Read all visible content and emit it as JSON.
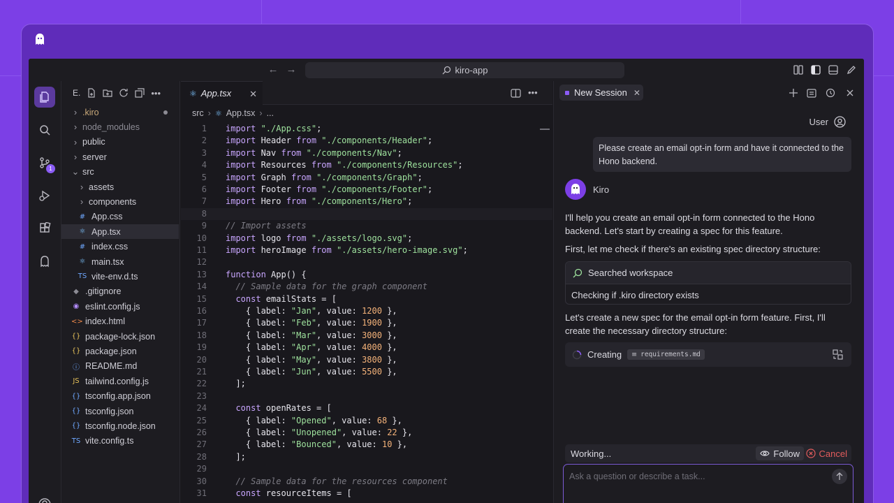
{
  "window": {
    "search": "kiro-app"
  },
  "explorer": {
    "title": "E.",
    "items": [
      {
        "label": ".kiro",
        "type": "folder",
        "open": false,
        "depth": 0,
        "color": "#c9a97a",
        "dot": true
      },
      {
        "label": "node_modules",
        "type": "folder",
        "open": false,
        "depth": 0,
        "dim": true
      },
      {
        "label": "public",
        "type": "folder",
        "open": false,
        "depth": 0
      },
      {
        "label": "server",
        "type": "folder",
        "open": false,
        "depth": 0
      },
      {
        "label": "src",
        "type": "folder",
        "open": true,
        "depth": 0
      },
      {
        "label": "assets",
        "type": "folder",
        "open": false,
        "depth": 1
      },
      {
        "label": "components",
        "type": "folder",
        "open": false,
        "depth": 1
      },
      {
        "label": "App.css",
        "type": "file",
        "icon": "#",
        "iconColor": "#6fa8ff",
        "depth": 1
      },
      {
        "label": "App.tsx",
        "type": "file",
        "icon": "⚛",
        "iconColor": "#7dc4ff",
        "depth": 1,
        "selected": true
      },
      {
        "label": "index.css",
        "type": "file",
        "icon": "#",
        "iconColor": "#6fa8ff",
        "depth": 1
      },
      {
        "label": "main.tsx",
        "type": "file",
        "icon": "⚛",
        "iconColor": "#7dc4ff",
        "depth": 1
      },
      {
        "label": "vite-env.d.ts",
        "type": "file",
        "icon": "TS",
        "iconColor": "#6fa8ff",
        "depth": 1
      },
      {
        "label": ".gitignore",
        "type": "file",
        "icon": "◆",
        "iconColor": "#8c8b94",
        "depth": 0
      },
      {
        "label": "eslint.config.js",
        "type": "file",
        "icon": "◉",
        "iconColor": "#b48cff",
        "depth": 0
      },
      {
        "label": "index.html",
        "type": "file",
        "icon": "<>",
        "iconColor": "#f08a4b",
        "depth": 0
      },
      {
        "label": "package-lock.json",
        "type": "file",
        "icon": "{}",
        "iconColor": "#e6c15a",
        "depth": 0
      },
      {
        "label": "package.json",
        "type": "file",
        "icon": "{}",
        "iconColor": "#e6c15a",
        "depth": 0
      },
      {
        "label": "README.md",
        "type": "file",
        "icon": "ⓘ",
        "iconColor": "#6fa8ff",
        "depth": 0
      },
      {
        "label": "tailwind.config.js",
        "type": "file",
        "icon": "JS",
        "iconColor": "#e6c15a",
        "depth": 0
      },
      {
        "label": "tsconfig.app.json",
        "type": "file",
        "icon": "{}",
        "iconColor": "#6fa8ff",
        "depth": 0
      },
      {
        "label": "tsconfig.json",
        "type": "file",
        "icon": "{}",
        "iconColor": "#6fa8ff",
        "depth": 0
      },
      {
        "label": "tsconfig.node.json",
        "type": "file",
        "icon": "{}",
        "iconColor": "#6fa8ff",
        "depth": 0
      },
      {
        "label": "vite.config.ts",
        "type": "file",
        "icon": "TS",
        "iconColor": "#6fa8ff",
        "depth": 0
      }
    ]
  },
  "activity": {
    "badge": "1"
  },
  "editor": {
    "tab": "App.tsx",
    "breadcrumb": {
      "folder": "src",
      "file": "App.tsx",
      "more": "..."
    },
    "current_line": 8,
    "lines": [
      [
        [
          "kw",
          "import "
        ],
        [
          "str",
          "\"./App.css\""
        ],
        [
          "id",
          ";"
        ]
      ],
      [
        [
          "kw",
          "import "
        ],
        [
          "id",
          "Header "
        ],
        [
          "kw",
          "from "
        ],
        [
          "str",
          "\"./components/Header\""
        ],
        [
          "id",
          ";"
        ]
      ],
      [
        [
          "kw",
          "import "
        ],
        [
          "id",
          "Nav "
        ],
        [
          "kw",
          "from "
        ],
        [
          "str",
          "\"./components/Nav\""
        ],
        [
          "id",
          ";"
        ]
      ],
      [
        [
          "kw",
          "import "
        ],
        [
          "id",
          "Resources "
        ],
        [
          "kw",
          "from "
        ],
        [
          "str",
          "\"./components/Resources\""
        ],
        [
          "id",
          ";"
        ]
      ],
      [
        [
          "kw",
          "import "
        ],
        [
          "id",
          "Graph "
        ],
        [
          "kw",
          "from "
        ],
        [
          "str",
          "\"./components/Graph\""
        ],
        [
          "id",
          ";"
        ]
      ],
      [
        [
          "kw",
          "import "
        ],
        [
          "id",
          "Footer "
        ],
        [
          "kw",
          "from "
        ],
        [
          "str",
          "\"./components/Footer\""
        ],
        [
          "id",
          ";"
        ]
      ],
      [
        [
          "kw",
          "import "
        ],
        [
          "id",
          "Hero "
        ],
        [
          "kw",
          "from "
        ],
        [
          "str",
          "\"./components/Hero\""
        ],
        [
          "id",
          ";"
        ]
      ],
      [],
      [
        [
          "cm",
          "// Import assets"
        ]
      ],
      [
        [
          "kw",
          "import "
        ],
        [
          "id",
          "logo "
        ],
        [
          "kw",
          "from "
        ],
        [
          "str",
          "\"./assets/logo.svg\""
        ],
        [
          "id",
          ";"
        ]
      ],
      [
        [
          "kw",
          "import "
        ],
        [
          "id",
          "heroImage "
        ],
        [
          "kw",
          "from "
        ],
        [
          "str",
          "\"./assets/hero-image.svg\""
        ],
        [
          "id",
          ";"
        ]
      ],
      [],
      [
        [
          "kw",
          "function "
        ],
        [
          "id",
          "App() {"
        ]
      ],
      [
        [
          "cm",
          "  // Sample data for the graph component"
        ]
      ],
      [
        [
          "kw",
          "  const "
        ],
        [
          "id",
          "emailStats = ["
        ]
      ],
      [
        [
          "id",
          "    { label: "
        ],
        [
          "str",
          "\"Jan\""
        ],
        [
          "id",
          ", value: "
        ],
        [
          "num",
          "1200"
        ],
        [
          "id",
          " },"
        ]
      ],
      [
        [
          "id",
          "    { label: "
        ],
        [
          "str",
          "\"Feb\""
        ],
        [
          "id",
          ", value: "
        ],
        [
          "num",
          "1900"
        ],
        [
          "id",
          " },"
        ]
      ],
      [
        [
          "id",
          "    { label: "
        ],
        [
          "str",
          "\"Mar\""
        ],
        [
          "id",
          ", value: "
        ],
        [
          "num",
          "3000"
        ],
        [
          "id",
          " },"
        ]
      ],
      [
        [
          "id",
          "    { label: "
        ],
        [
          "str",
          "\"Apr\""
        ],
        [
          "id",
          ", value: "
        ],
        [
          "num",
          "4000"
        ],
        [
          "id",
          " },"
        ]
      ],
      [
        [
          "id",
          "    { label: "
        ],
        [
          "str",
          "\"May\""
        ],
        [
          "id",
          ", value: "
        ],
        [
          "num",
          "3800"
        ],
        [
          "id",
          " },"
        ]
      ],
      [
        [
          "id",
          "    { label: "
        ],
        [
          "str",
          "\"Jun\""
        ],
        [
          "id",
          ", value: "
        ],
        [
          "num",
          "5500"
        ],
        [
          "id",
          " },"
        ]
      ],
      [
        [
          "id",
          "  ];"
        ]
      ],
      [],
      [
        [
          "kw",
          "  const "
        ],
        [
          "id",
          "openRates = ["
        ]
      ],
      [
        [
          "id",
          "    { label: "
        ],
        [
          "str",
          "\"Opened\""
        ],
        [
          "id",
          ", value: "
        ],
        [
          "num",
          "68"
        ],
        [
          "id",
          " },"
        ]
      ],
      [
        [
          "id",
          "    { label: "
        ],
        [
          "str",
          "\"Unopened\""
        ],
        [
          "id",
          ", value: "
        ],
        [
          "num",
          "22"
        ],
        [
          "id",
          " },"
        ]
      ],
      [
        [
          "id",
          "    { label: "
        ],
        [
          "str",
          "\"Bounced\""
        ],
        [
          "id",
          ", value: "
        ],
        [
          "num",
          "10"
        ],
        [
          "id",
          " },"
        ]
      ],
      [
        [
          "id",
          "  ];"
        ]
      ],
      [],
      [
        [
          "cm",
          "  // Sample data for the resources component"
        ]
      ],
      [
        [
          "kw",
          "  const "
        ],
        [
          "id",
          "resourceItems = ["
        ]
      ]
    ]
  },
  "chat": {
    "session_tab": "New Session",
    "user_label": "User",
    "user_message": "Please create an email opt-in form and have it connected to the Hono backend.",
    "agent_name": "Kiro",
    "p1": "I'll help you create an email opt-in form connected to the Hono backend. Let's start by creating a spec for this feature.",
    "p2": "First, let me check if there's an existing spec directory structure:",
    "tool_title": "Searched workspace",
    "tool_detail": "Checking if .kiro directory exists",
    "p3": "Let's create a new spec for the email opt-in form feature. First, I'll create the necessary directory structure:",
    "creating_label": "Creating",
    "creating_file": "requirements.md",
    "status": "Working...",
    "follow": "Follow",
    "cancel": "Cancel",
    "input_placeholder": "Ask a question or describe a task..."
  }
}
